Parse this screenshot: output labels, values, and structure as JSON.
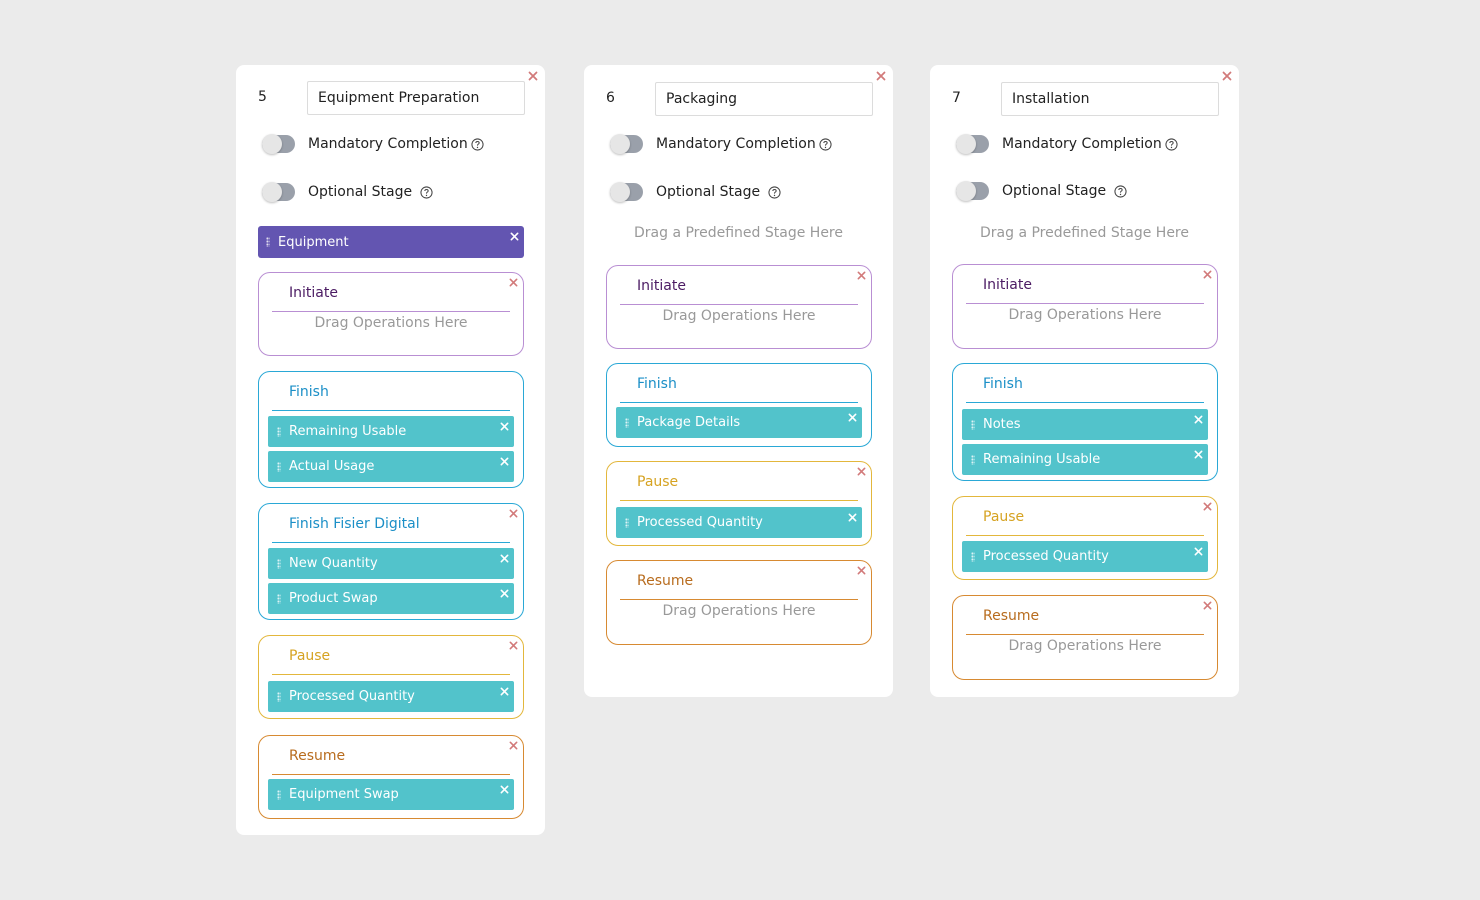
{
  "common": {
    "mandatory_label": "Mandatory Completion",
    "optional_label": "Optional Stage",
    "drag_stage_hint": "Drag a Predefined Stage Here",
    "drag_ops_hint": "Drag Operations Here"
  },
  "colors": {
    "predefined_pill": "#6355b1",
    "operation_item": "#52c3cb",
    "initiate": "#b98fd3",
    "finish": "#2aa8d6",
    "pause": "#e3b73c",
    "resume": "#d78a32",
    "close": "#d27a7a"
  },
  "stages": [
    {
      "number": "5",
      "name": "Equipment Preparation",
      "predefined_stage": "Equipment",
      "operations": [
        {
          "title": "Initiate",
          "items": []
        },
        {
          "title": "Finish",
          "items": [
            "Remaining Usable",
            "Actual Usage"
          ]
        },
        {
          "title": "Finish Fisier Digital",
          "items": [
            "New Quantity",
            "Product Swap"
          ]
        },
        {
          "title": "Pause",
          "items": [
            "Processed Quantity"
          ]
        },
        {
          "title": "Resume",
          "items": [
            "Equipment Swap"
          ]
        }
      ]
    },
    {
      "number": "6",
      "name": "Packaging",
      "predefined_stage": "",
      "operations": [
        {
          "title": "Initiate",
          "items": []
        },
        {
          "title": "Finish",
          "items": [
            "Package Details"
          ]
        },
        {
          "title": "Pause",
          "items": [
            "Processed Quantity"
          ]
        },
        {
          "title": "Resume",
          "items": []
        }
      ]
    },
    {
      "number": "7",
      "name": "Installation",
      "predefined_stage": "",
      "operations": [
        {
          "title": "Initiate",
          "items": []
        },
        {
          "title": "Finish",
          "items": [
            "Notes",
            "Remaining Usable"
          ]
        },
        {
          "title": "Pause",
          "items": [
            "Processed Quantity"
          ]
        },
        {
          "title": "Resume",
          "items": []
        }
      ]
    }
  ]
}
